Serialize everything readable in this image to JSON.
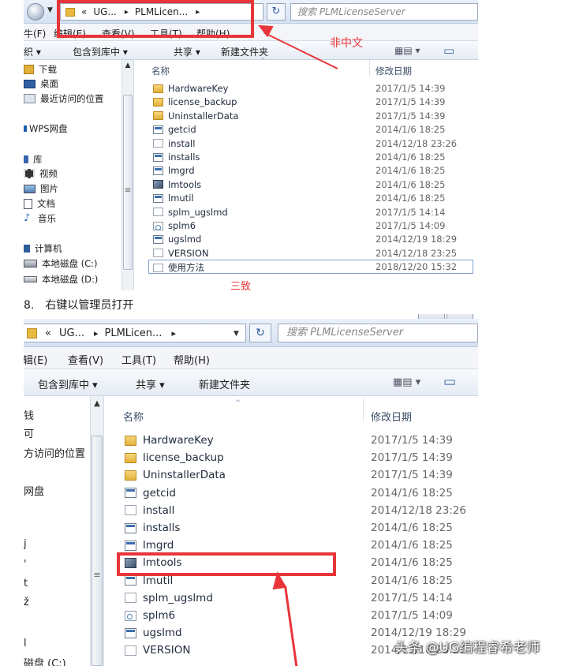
{
  "explorer": {
    "path_back": "«",
    "path_seg1": "UG...",
    "path_seg2": "PLMLicen...",
    "path_sep": "▸",
    "search_placeholder": "搜索 PLMLicenseServer",
    "menu": [
      "编辑(E)",
      "查看(V)",
      "工具(T)",
      "帮助(H)"
    ],
    "menu_partial_1": "牛(F)",
    "menu_partial_1_edit": "编辑(E)",
    "menu_partial_2": "辑辑(E)",
    "toolbar": [
      "组织 ▾",
      "包含到库中 ▾",
      "共享 ▾",
      "新建文件夹"
    ],
    "toolbar_partial_1": "织 ▾",
    "view_icon": "▦▤ ▾",
    "pane_icon": "▭",
    "col_name": "名称",
    "col_date": "修改日期",
    "nav_items_1": [
      {
        "label": "下载",
        "icon": "download-folder-icon"
      },
      {
        "label": "桌面",
        "icon": "desktop-icon"
      },
      {
        "label": "最近访问的位置",
        "icon": "recent-places-icon"
      },
      {
        "label": "WPS网盘",
        "icon": "cloud-drive-icon"
      },
      {
        "label": "库",
        "icon": "library-icon"
      },
      {
        "label": "视频",
        "icon": "video-icon"
      },
      {
        "label": "图片",
        "icon": "picture-icon"
      },
      {
        "label": "文档",
        "icon": "document-icon"
      },
      {
        "label": "音乐",
        "icon": "music-icon"
      },
      {
        "label": "计算机",
        "icon": "computer-icon"
      },
      {
        "label": "本地磁盘 (C:)",
        "icon": "disk-icon"
      },
      {
        "label": "本地磁盘 (D:)",
        "icon": "disk-icon"
      }
    ],
    "nav_items_2": [
      {
        "label": "钱"
      },
      {
        "label": "可"
      },
      {
        "label": "方访问的位置"
      },
      {
        "label": "网盘"
      },
      {
        "label": "j"
      },
      {
        "label": "'"
      },
      {
        "label": "t"
      },
      {
        "label": "ž"
      },
      {
        "label": "l"
      },
      {
        "label": "磁盘 (C:)"
      }
    ],
    "files": [
      {
        "name": "HardwareKey",
        "date": "2017/1/5 14:39",
        "type": "folder"
      },
      {
        "name": "license_backup",
        "date": "2017/1/5 14:39",
        "type": "folder"
      },
      {
        "name": "UninstallerData",
        "date": "2017/1/5 14:39",
        "type": "folder"
      },
      {
        "name": "getcid",
        "date": "2014/1/6 18:25",
        "type": "exe"
      },
      {
        "name": "install",
        "date": "2014/12/18 23:26",
        "type": "doc"
      },
      {
        "name": "installs",
        "date": "2014/1/6 18:25",
        "type": "exe"
      },
      {
        "name": "lmgrd",
        "date": "2014/1/6 18:25",
        "type": "exe"
      },
      {
        "name": "lmtools",
        "date": "2014/1/6 18:25",
        "type": "lm"
      },
      {
        "name": "lmutil",
        "date": "2014/1/6 18:25",
        "type": "exe"
      },
      {
        "name": "splm_ugslmd",
        "date": "2017/1/5 14:14",
        "type": "doc"
      },
      {
        "name": "splm6",
        "date": "2017/1/5 14:09",
        "type": "cfg"
      },
      {
        "name": "ugslmd",
        "date": "2014/12/19 18:29",
        "type": "exe"
      },
      {
        "name": "VERSION",
        "date": "2014/12/18 23:25",
        "type": "doc"
      },
      {
        "name": "使用方法",
        "date": "2018/12/20 15:32",
        "type": "doc"
      }
    ]
  },
  "annotations": {
    "non_chinese": "非中文",
    "consistent": "三致"
  },
  "step": {
    "number": "8.",
    "text": "右键以管理员打开"
  },
  "watermark": "头条 @UG编程睿希老师",
  "colors": {
    "highlight_red": "#e8353a",
    "selection_border": "#7da2ce"
  }
}
